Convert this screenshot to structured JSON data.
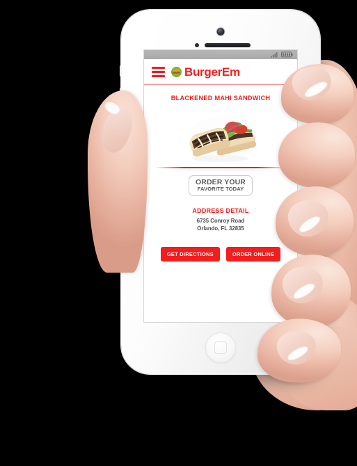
{
  "device": {
    "type": "white-smartphone",
    "held_by": "right hand",
    "background_color": "#000000"
  },
  "statusbar": {
    "signal_icon": "signal-bars-icon",
    "battery_icon": "battery-icon"
  },
  "appbar": {
    "menu_icon": "hamburger-menu-icon",
    "logo_icon": "burger-logo-icon",
    "brand_name": "BurgerEm",
    "brand_color": "#f41d1d"
  },
  "main": {
    "dish_title": "BLACKENED MAHI SANDWICH",
    "dish_image_alt": "blackened mahi fish sandwich on a roll with lettuce, tomato and red onion",
    "badge": {
      "line1": "ORDER YOUR",
      "line2": "FAVORITE TODAY"
    },
    "address": {
      "heading": "ADDRESS DETAIL",
      "street": "6735 Conroy Road",
      "city_state_zip": "Orlando, FL 32835"
    },
    "buttons": [
      {
        "label": "GET DIRECTIONS",
        "name": "get-directions-button"
      },
      {
        "label": "ORDER ONLINE",
        "name": "order-online-button"
      }
    ]
  },
  "colors": {
    "accent_red": "#f41d1d",
    "divider_pink": "#f7928f",
    "text_gray": "#4d4d4d",
    "badge_gray": "#5b5b5b"
  }
}
